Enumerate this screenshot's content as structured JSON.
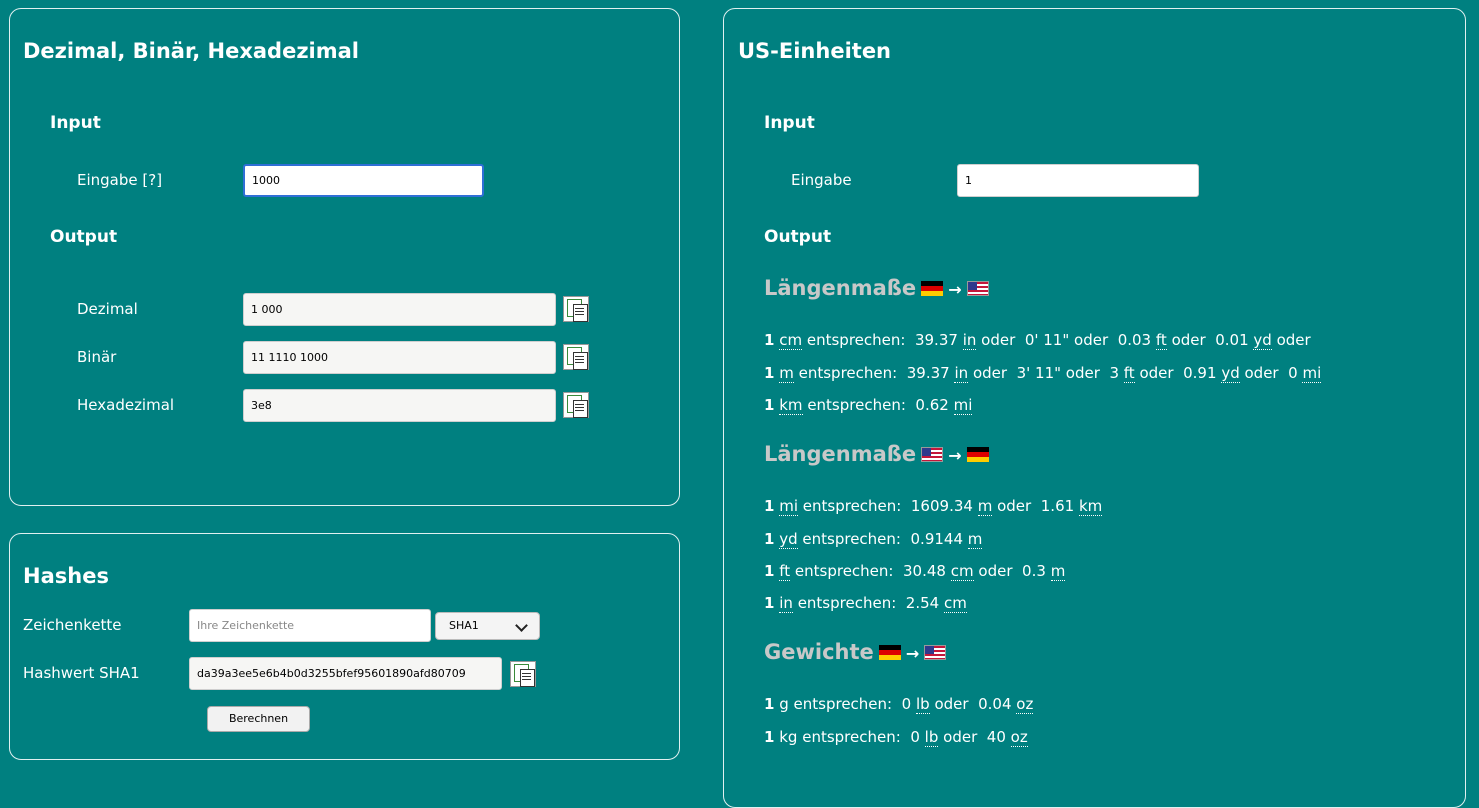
{
  "converter": {
    "title": "Dezimal, Binär, Hexadezimal",
    "input_heading": "Input",
    "input_label": "Eingabe [?]",
    "input_value": "1000",
    "output_heading": "Output",
    "outputs": [
      {
        "label": "Dezimal",
        "value": "1 000"
      },
      {
        "label": "Binär",
        "value": "11 1110 1000"
      },
      {
        "label": "Hexadezimal",
        "value": "3e8"
      }
    ]
  },
  "hashes": {
    "title": "Hashes",
    "string_label": "Zeichenkette",
    "string_placeholder": "Ihre Zeichenkette",
    "algorithm": "SHA1",
    "hash_label": "Hashwert SHA1",
    "hash_value": "da39a3ee5e6b4b0d3255bfef95601890afd80709",
    "button_label": "Berechnen"
  },
  "us": {
    "title": "US-Einheiten",
    "input_heading": "Input",
    "input_label": "Eingabe",
    "input_value": "1",
    "output_heading": "Output",
    "sections": [
      {
        "title": "Längenmaße",
        "from_flag": "de-flag-icon",
        "to_flag": "us-flag-icon",
        "arrow": "→",
        "rows": [
          {
            "qty": "1",
            "unit": "cm",
            "word": "entsprechen:",
            "parts": [
              {
                "val": "39.37",
                "unit": "in",
                "sep": "oder"
              },
              {
                "val": "0' 11\"",
                "unit": "",
                "sep": "oder"
              },
              {
                "val": "0.03",
                "unit": "ft",
                "sep": "oder"
              },
              {
                "val": "0.01",
                "unit": "yd",
                "sep": "oder"
              }
            ]
          },
          {
            "qty": "1",
            "unit": "m",
            "word": "entsprechen:",
            "parts": [
              {
                "val": "39.37",
                "unit": "in",
                "sep": "oder"
              },
              {
                "val": "3' 11\"",
                "unit": "",
                "sep": "oder"
              },
              {
                "val": "3",
                "unit": "ft",
                "sep": "oder"
              },
              {
                "val": "0.91",
                "unit": "yd",
                "sep": "oder"
              },
              {
                "val": "0",
                "unit": "mi",
                "sep": ""
              }
            ]
          },
          {
            "qty": "1",
            "unit": "km",
            "word": "entsprechen:",
            "parts": [
              {
                "val": "0.62",
                "unit": "mi",
                "sep": ""
              }
            ]
          }
        ]
      },
      {
        "title": "Längenmaße",
        "from_flag": "us-flag-icon",
        "to_flag": "de-flag-icon",
        "arrow": "→",
        "rows": [
          {
            "qty": "1",
            "unit": "mi",
            "word": "entsprechen:",
            "parts": [
              {
                "val": "1609.34",
                "unit": "m",
                "sep": "oder"
              },
              {
                "val": "1.61",
                "unit": "km",
                "sep": ""
              }
            ]
          },
          {
            "qty": "1",
            "unit": "yd",
            "word": "entsprechen:",
            "parts": [
              {
                "val": "0.9144",
                "unit": "m",
                "sep": ""
              }
            ]
          },
          {
            "qty": "1",
            "unit": "ft",
            "word": "entsprechen:",
            "parts": [
              {
                "val": "30.48",
                "unit": "cm",
                "sep": "oder"
              },
              {
                "val": "0.3",
                "unit": "m",
                "sep": ""
              }
            ]
          },
          {
            "qty": "1",
            "unit": "in",
            "word": "entsprechen:",
            "parts": [
              {
                "val": "2.54",
                "unit": "cm",
                "sep": ""
              }
            ]
          }
        ]
      },
      {
        "title": "Gewichte",
        "from_flag": "de-flag-icon",
        "to_flag": "us-flag-icon",
        "arrow": "→",
        "rows": [
          {
            "qty": "1",
            "unit": "g",
            "word": "entsprechen:",
            "parts": [
              {
                "val": "0",
                "unit": "lb",
                "sep": "oder"
              },
              {
                "val": "0.04",
                "unit": "oz",
                "sep": ""
              }
            ]
          },
          {
            "qty": "1",
            "unit": "kg",
            "word": "entsprechen:",
            "parts": [
              {
                "val": "0",
                "unit": "lb",
                "sep": "oder"
              },
              {
                "val": "40",
                "unit": "oz",
                "sep": ""
              }
            ]
          }
        ]
      }
    ]
  }
}
